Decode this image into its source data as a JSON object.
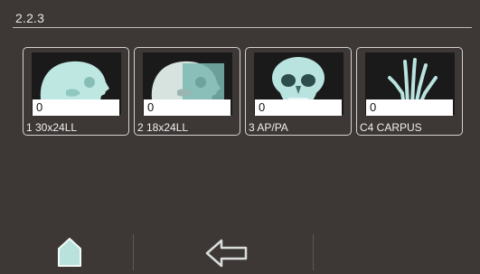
{
  "screen": {
    "title": "2.2.3"
  },
  "thumbnails": [
    {
      "label": "1 30x24LL",
      "count": "0",
      "icon": "skull-lateral-xray-icon"
    },
    {
      "label": "2 18x24LL",
      "count": "0",
      "icon": "skull-lateral-xray-icon"
    },
    {
      "label": "3 AP/PA",
      "count": "0",
      "icon": "skull-frontal-xray-icon"
    },
    {
      "label": "C4 CARPUS",
      "count": "0",
      "icon": "hand-xray-icon"
    }
  ],
  "nav": {
    "home_icon": "home-icon",
    "back_icon": "back-arrow-icon"
  },
  "colors": {
    "background": "#3d3836",
    "bone": "#b9e3df",
    "thumbnail_border": "#d2d2d2"
  }
}
